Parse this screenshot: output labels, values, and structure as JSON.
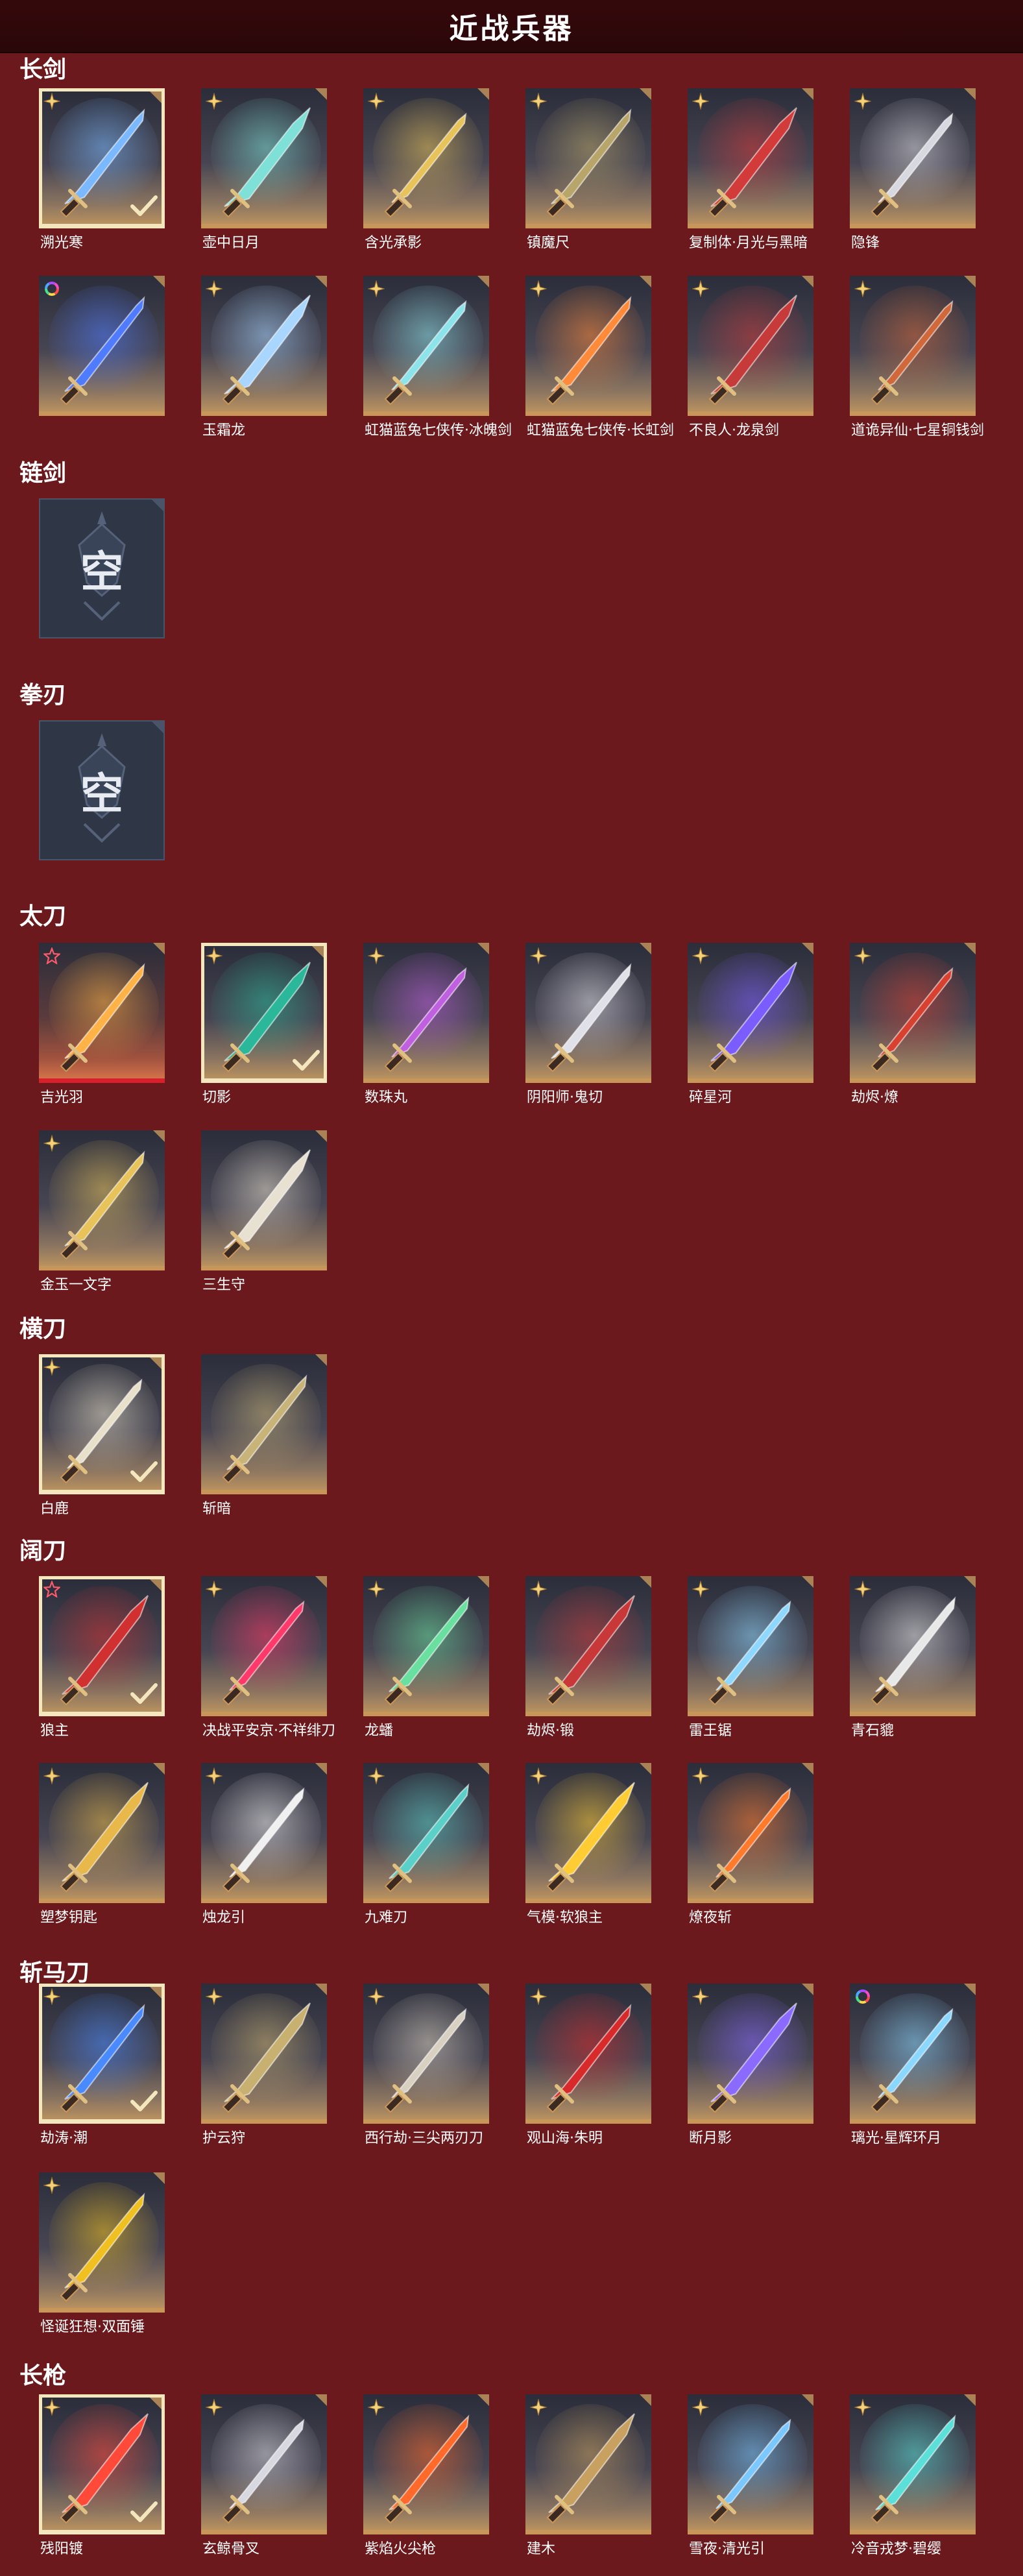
{
  "header": {
    "title": "近战兵器"
  },
  "colors": {
    "background": "#6b191d",
    "header": "#2a0709",
    "card_gold": "#c9965a",
    "selected_border": "#f5e7bd",
    "featured_red": "#d8202c",
    "empty_card": "#2f3747"
  },
  "sections": [
    {
      "title": "长剑",
      "items": [
        {
          "name": "溯光寒",
          "badge": "gold-star-icon",
          "selected": true,
          "accent": "#7ab8ff"
        },
        {
          "name": "壶中日月",
          "badge": "gold-star-icon",
          "selected": false,
          "accent": "#7ee0d6"
        },
        {
          "name": "含光承影",
          "badge": "gold-star-icon",
          "selected": false,
          "accent": "#e8c35a"
        },
        {
          "name": "镇魔尺",
          "badge": "gold-star-icon",
          "selected": false,
          "accent": "#b8a56a"
        },
        {
          "name": "复制体·月光与黑暗",
          "badge": "gold-star-icon",
          "selected": false,
          "accent": "#d33a3a"
        },
        {
          "name": "隐锋",
          "badge": "gold-star-icon",
          "selected": false,
          "accent": "#d8d8e0"
        },
        {
          "name": "",
          "badge": "rainbow-ring-icon",
          "selected": false,
          "accent": "#4f7bff"
        },
        {
          "name": "玉霜龙",
          "badge": "gold-star-icon",
          "selected": false,
          "accent": "#a9d6ff"
        },
        {
          "name": "虹猫蓝兔七侠传·冰魄剑",
          "badge": "gold-star-icon",
          "selected": false,
          "accent": "#8de3ea"
        },
        {
          "name": "虹猫蓝兔七侠传·长虹剑",
          "badge": "gold-star-icon",
          "selected": false,
          "accent": "#ff8a3a"
        },
        {
          "name": "不良人·龙泉剑",
          "badge": "gold-star-icon",
          "selected": false,
          "accent": "#c73a3a"
        },
        {
          "name": "道诡异仙·七星铜钱剑",
          "badge": "gold-star-icon",
          "selected": false,
          "accent": "#d0683a"
        }
      ]
    },
    {
      "title": "链剑",
      "items": [
        {
          "name": "",
          "empty": true,
          "empty_label": "空"
        }
      ]
    },
    {
      "title": "拳刃",
      "items": [
        {
          "name": "",
          "empty": true,
          "empty_label": "空"
        }
      ]
    },
    {
      "title": "太刀",
      "items": [
        {
          "name": "吉光羽",
          "badge": "red-star-icon",
          "selected": false,
          "featured": true,
          "accent": "#ffb347"
        },
        {
          "name": "切影",
          "badge": "gold-star-icon",
          "selected": true,
          "accent": "#2bb89a"
        },
        {
          "name": "数珠丸",
          "badge": "gold-star-icon",
          "selected": false,
          "accent": "#c060e0"
        },
        {
          "name": "阴阳师·鬼切",
          "badge": "gold-star-icon",
          "selected": false,
          "accent": "#e0e0e8"
        },
        {
          "name": "碎星河",
          "badge": "gold-star-icon",
          "selected": false,
          "accent": "#7a5cff"
        },
        {
          "name": "劫烬·燎",
          "badge": "gold-star-icon",
          "selected": false,
          "accent": "#d84030"
        },
        {
          "name": "金玉一文字",
          "badge": "gold-star-icon",
          "selected": false,
          "accent": "#e8c35a"
        },
        {
          "name": "三生守",
          "badge": "",
          "selected": false,
          "accent": "#e8e0d0"
        }
      ]
    },
    {
      "title": "横刀",
      "items": [
        {
          "name": "白鹿",
          "badge": "gold-star-icon",
          "selected": true,
          "accent": "#e8e0c8"
        },
        {
          "name": "斩暗",
          "badge": "",
          "selected": false,
          "accent": "#c8b478"
        }
      ]
    },
    {
      "title": "阔刀",
      "items": [
        {
          "name": "狼主",
          "badge": "red-star-icon",
          "selected": true,
          "accent": "#d03030"
        },
        {
          "name": "决战平安京·不祥绯刀",
          "badge": "gold-star-icon",
          "selected": false,
          "accent": "#ff3a6a"
        },
        {
          "name": "龙蟠",
          "badge": "gold-star-icon",
          "selected": false,
          "accent": "#6ae0a0"
        },
        {
          "name": "劫烬·锻",
          "badge": "gold-star-icon",
          "selected": false,
          "accent": "#c83838"
        },
        {
          "name": "雷王锯",
          "badge": "gold-star-icon",
          "selected": false,
          "accent": "#8ed8ff"
        },
        {
          "name": "青石貔",
          "badge": "gold-star-icon",
          "selected": false,
          "accent": "#e8e8e8"
        },
        {
          "name": "塑梦钥匙",
          "badge": "gold-star-icon",
          "selected": false,
          "accent": "#e8b84a"
        },
        {
          "name": "烛龙引",
          "badge": "gold-star-icon",
          "selected": false,
          "accent": "#f0f0f0"
        },
        {
          "name": "九难刀",
          "badge": "gold-star-icon",
          "selected": false,
          "accent": "#5ad0c8"
        },
        {
          "name": "气模·软狼主",
          "badge": "gold-star-icon",
          "selected": false,
          "accent": "#ffcc33"
        },
        {
          "name": "燎夜斩",
          "badge": "gold-star-icon",
          "selected": false,
          "accent": "#ff7a2a"
        }
      ]
    },
    {
      "title": "斩马刀",
      "items": [
        {
          "name": "劫涛·潮",
          "badge": "gold-star-icon",
          "selected": true,
          "accent": "#4a8aff"
        },
        {
          "name": "护云狩",
          "badge": "gold-star-icon",
          "selected": false,
          "accent": "#c8b070"
        },
        {
          "name": "西行劫·三尖两刃刀",
          "badge": "gold-star-icon",
          "selected": false,
          "accent": "#d8d0c0"
        },
        {
          "name": "观山海·朱明",
          "badge": "gold-star-icon",
          "selected": false,
          "accent": "#d82a2a"
        },
        {
          "name": "断月影",
          "badge": "gold-star-icon",
          "selected": false,
          "accent": "#8a6aff"
        },
        {
          "name": "璃光·星辉环月",
          "badge": "rainbow-ring-icon",
          "selected": false,
          "accent": "#8ad8ff"
        },
        {
          "name": "怪诞狂想·双面锤",
          "badge": "gold-star-icon",
          "selected": false,
          "accent": "#f0c020"
        }
      ]
    },
    {
      "title": "长枪",
      "items": [
        {
          "name": "残阳镀",
          "badge": "gold-star-icon",
          "selected": true,
          "accent": "#ff4a3a"
        },
        {
          "name": "玄鲸骨叉",
          "badge": "gold-star-icon",
          "selected": false,
          "accent": "#d8d8e0"
        },
        {
          "name": "紫焰火尖枪",
          "badge": "gold-star-icon",
          "selected": false,
          "accent": "#ff6a2a"
        },
        {
          "name": "建木",
          "badge": "gold-star-icon",
          "selected": false,
          "accent": "#c8a060"
        },
        {
          "name": "雪夜·清光引",
          "badge": "gold-star-icon",
          "selected": false,
          "accent": "#7ac8ff"
        },
        {
          "name": "冷音戎梦·碧缨",
          "badge": "gold-star-icon",
          "selected": false,
          "accent": "#5ae0d8"
        }
      ]
    }
  ]
}
